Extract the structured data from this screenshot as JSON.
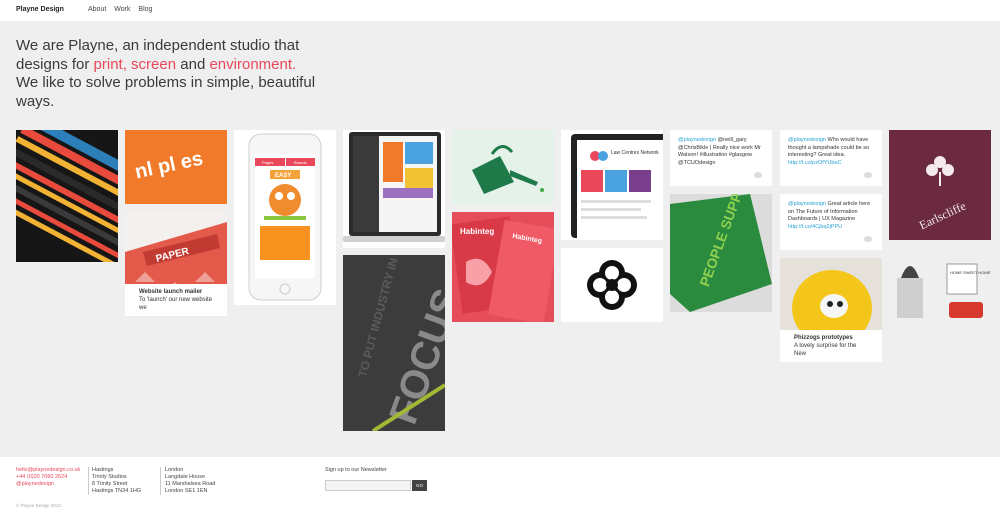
{
  "header": {
    "brand": "Playne Design",
    "nav": [
      "About",
      "Work",
      "Blog"
    ]
  },
  "hero": {
    "line_prefix": "We are Playne, an independent studio that designs for ",
    "accent1": "print, screen",
    "mid": " and ",
    "accent2": "environment.",
    "line_suffix": " We like to solve problems in simple, beautiful ways."
  },
  "tiles": {
    "website_launch": {
      "title": "Website launch mailer",
      "text": "To 'launch' our new website we"
    },
    "phizzogs": {
      "title": "Phizzogs prototypes",
      "text": "A lovely surprise for the New"
    },
    "tweet1": {
      "handle": "@playnedesign",
      "text": " @neill_gary @ChrisBikle | Really nice work Mr Watson! #illustration #glasgow @TCUOdesign"
    },
    "tweet2": {
      "handle": "@playnedesign",
      "text": " Who would have thought a lampshade could be so interesting? Great idea. ",
      "link": "http://t.co/pzOfYUbeC"
    },
    "tweet3": {
      "handle": "@playnedesign",
      "text": " Great article here on The Future of Information Dashboards | UX Magazine ",
      "link": "http://t.co/4Cjbq2jPPU"
    },
    "paper_word": "PAPER",
    "habinteg": "Habinteg",
    "focus": "FOCUS",
    "industry": "TO PUT INDUSTRY IN",
    "support": "PEOPLE SUPPORT",
    "earlscliffe": "Earlscliffe",
    "law_centres": "Law Centres Network",
    "app_buttons": [
      "Pages",
      "Brands"
    ],
    "app_tag": "EASY",
    "home_sweet": "HOME SWEET HOME",
    "letters": "nl pl es"
  },
  "footer": {
    "email": "hello@playnedesign.co.uk",
    "phone": "+44 (0)20 7060 2624",
    "twitter": "@playnedesign",
    "hastings": [
      "Hastings",
      "Trinity Studios",
      "8 Trinity Street",
      "Hastings TN34 1HG"
    ],
    "london": [
      "London",
      "Langdale House",
      "11 Marshalsea Road",
      "London SE1 1EN"
    ],
    "newsletter_label": "Sign up to our Newsletter",
    "newsletter_placeholder": "",
    "go": "GO",
    "copyright": "© Playne Design 2013"
  },
  "colors": {
    "accent": "#e8485a",
    "tweet_link": "#2ba3d5"
  }
}
